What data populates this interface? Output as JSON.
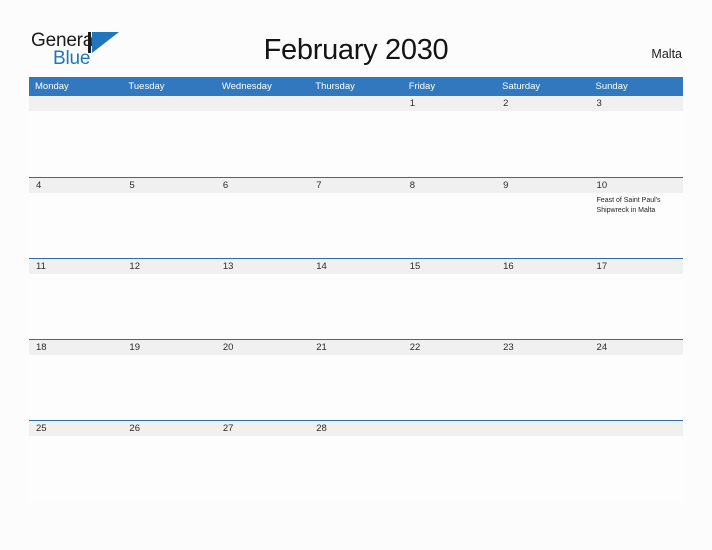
{
  "brand": {
    "name_part1": "General",
    "name_part2": "Blue",
    "mark": "triangle-logo-icon"
  },
  "header": {
    "title": "February 2030",
    "country": "Malta"
  },
  "calendar": {
    "weekdays": [
      "Monday",
      "Tuesday",
      "Wednesday",
      "Thursday",
      "Friday",
      "Saturday",
      "Sunday"
    ],
    "accent_color": "#3178be",
    "row_divider_color": "#2e6ea8",
    "daynum_strip_color": "#f0f0f0",
    "weeks": [
      {
        "days": [
          {
            "num": "",
            "event": ""
          },
          {
            "num": "",
            "event": ""
          },
          {
            "num": "",
            "event": ""
          },
          {
            "num": "",
            "event": ""
          },
          {
            "num": "1",
            "event": ""
          },
          {
            "num": "2",
            "event": ""
          },
          {
            "num": "3",
            "event": ""
          }
        ]
      },
      {
        "days": [
          {
            "num": "4",
            "event": ""
          },
          {
            "num": "5",
            "event": ""
          },
          {
            "num": "6",
            "event": ""
          },
          {
            "num": "7",
            "event": ""
          },
          {
            "num": "8",
            "event": ""
          },
          {
            "num": "9",
            "event": ""
          },
          {
            "num": "10",
            "event": "Feast of Saint Paul's Shipwreck in Malta"
          }
        ]
      },
      {
        "days": [
          {
            "num": "11",
            "event": ""
          },
          {
            "num": "12",
            "event": ""
          },
          {
            "num": "13",
            "event": ""
          },
          {
            "num": "14",
            "event": ""
          },
          {
            "num": "15",
            "event": ""
          },
          {
            "num": "16",
            "event": ""
          },
          {
            "num": "17",
            "event": ""
          }
        ]
      },
      {
        "days": [
          {
            "num": "18",
            "event": ""
          },
          {
            "num": "19",
            "event": ""
          },
          {
            "num": "20",
            "event": ""
          },
          {
            "num": "21",
            "event": ""
          },
          {
            "num": "22",
            "event": ""
          },
          {
            "num": "23",
            "event": ""
          },
          {
            "num": "24",
            "event": ""
          }
        ]
      },
      {
        "days": [
          {
            "num": "25",
            "event": ""
          },
          {
            "num": "26",
            "event": ""
          },
          {
            "num": "27",
            "event": ""
          },
          {
            "num": "28",
            "event": ""
          },
          {
            "num": "",
            "event": ""
          },
          {
            "num": "",
            "event": ""
          },
          {
            "num": "",
            "event": ""
          }
        ]
      }
    ]
  }
}
